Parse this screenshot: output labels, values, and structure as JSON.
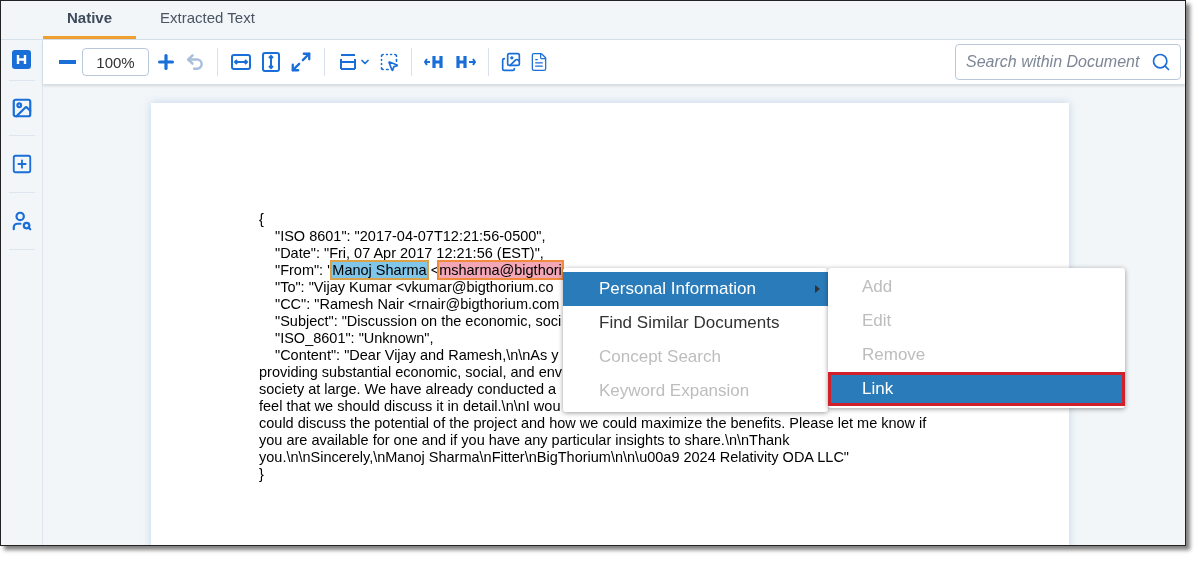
{
  "tabs": [
    {
      "label": "Native",
      "selected": true
    },
    {
      "label": "Extracted Text",
      "selected": false
    }
  ],
  "toolbar": {
    "zoom": "100%",
    "search": {
      "placeholder": "Search within Document"
    }
  },
  "document": {
    "lines": [
      {
        "indent": false,
        "segments": [
          {
            "kind": "plain",
            "text": "{"
          }
        ]
      },
      {
        "indent": true,
        "segments": [
          {
            "kind": "plain",
            "text": "\"ISO 8601\": \"2017-04-07T12:21:56-0500\","
          }
        ]
      },
      {
        "indent": true,
        "segments": [
          {
            "kind": "plain",
            "text": "\"Date\": \"Fri, 07 Apr 2017 12:21:56 (EST)\","
          }
        ]
      },
      {
        "indent": true,
        "segments": [
          {
            "kind": "plain",
            "text": "\"From\": \""
          },
          {
            "kind": "name",
            "text": "Manoj Sharma"
          },
          {
            "kind": "plain",
            "text": " <"
          },
          {
            "kind": "email",
            "text": "msharma@bigthori"
          }
        ]
      },
      {
        "indent": true,
        "segments": [
          {
            "kind": "plain",
            "text": "\"To\": \"Vijay Kumar <vkumar@bigthorium.co"
          }
        ]
      },
      {
        "indent": true,
        "segments": [
          {
            "kind": "plain",
            "text": "\"CC\": \"Ramesh Nair <rnair@bigthorium.com"
          }
        ]
      },
      {
        "indent": true,
        "segments": [
          {
            "kind": "plain",
            "text": "\"Subject\": \"Discussion on the economic, soci"
          }
        ]
      },
      {
        "indent": true,
        "segments": [
          {
            "kind": "plain",
            "text": "\"ISO_8601\": \"Unknown\","
          }
        ]
      },
      {
        "indent": true,
        "segments": [
          {
            "kind": "plain",
            "text": "\"Content\": \"Dear Vijay and Ramesh,\\n\\nAs y"
          }
        ]
      },
      {
        "indent": false,
        "segments": [
          {
            "kind": "plain",
            "text": "providing substantial economic, social, and env"
          }
        ]
      },
      {
        "indent": false,
        "segments": [
          {
            "kind": "plain",
            "text": "society at large. We have already conducted a"
          }
        ]
      },
      {
        "indent": false,
        "segments": [
          {
            "kind": "plain",
            "text": "feel that we should discuss it in detail.\\n\\nI wou"
          }
        ]
      },
      {
        "indent": false,
        "segments": [
          {
            "kind": "plain",
            "text": "could discuss the potential of the project and how we could maximize the benefits. Please let me know if"
          }
        ]
      },
      {
        "indent": false,
        "segments": [
          {
            "kind": "plain",
            "text": "you are available for one and if you have any particular insights to share.\\n\\nThank"
          }
        ]
      },
      {
        "indent": false,
        "segments": [
          {
            "kind": "plain",
            "text": "you.\\n\\nSincerely,\\nManoj Sharma\\nFitter\\nBigThorium\\n\\n\\u00a9 2024 Relativity ODA LLC\""
          }
        ]
      },
      {
        "indent": false,
        "segments": [
          {
            "kind": "plain",
            "text": "}"
          }
        ]
      }
    ]
  },
  "context_menu": {
    "items": [
      {
        "label": "Personal Information",
        "selected": true,
        "disabled": false,
        "submenu": true
      },
      {
        "label": "Find Similar Documents",
        "selected": false,
        "disabled": false,
        "submenu": false
      },
      {
        "label": "Concept Search",
        "selected": false,
        "disabled": true,
        "submenu": false
      },
      {
        "label": "Keyword Expansion",
        "selected": false,
        "disabled": true,
        "submenu": false
      }
    ],
    "submenu": [
      {
        "label": "Add",
        "selected": false,
        "disabled": true
      },
      {
        "label": "Edit",
        "selected": false,
        "disabled": true
      },
      {
        "label": "Remove",
        "selected": false,
        "disabled": true
      },
      {
        "label": "Link",
        "selected": true,
        "disabled": false
      }
    ]
  }
}
